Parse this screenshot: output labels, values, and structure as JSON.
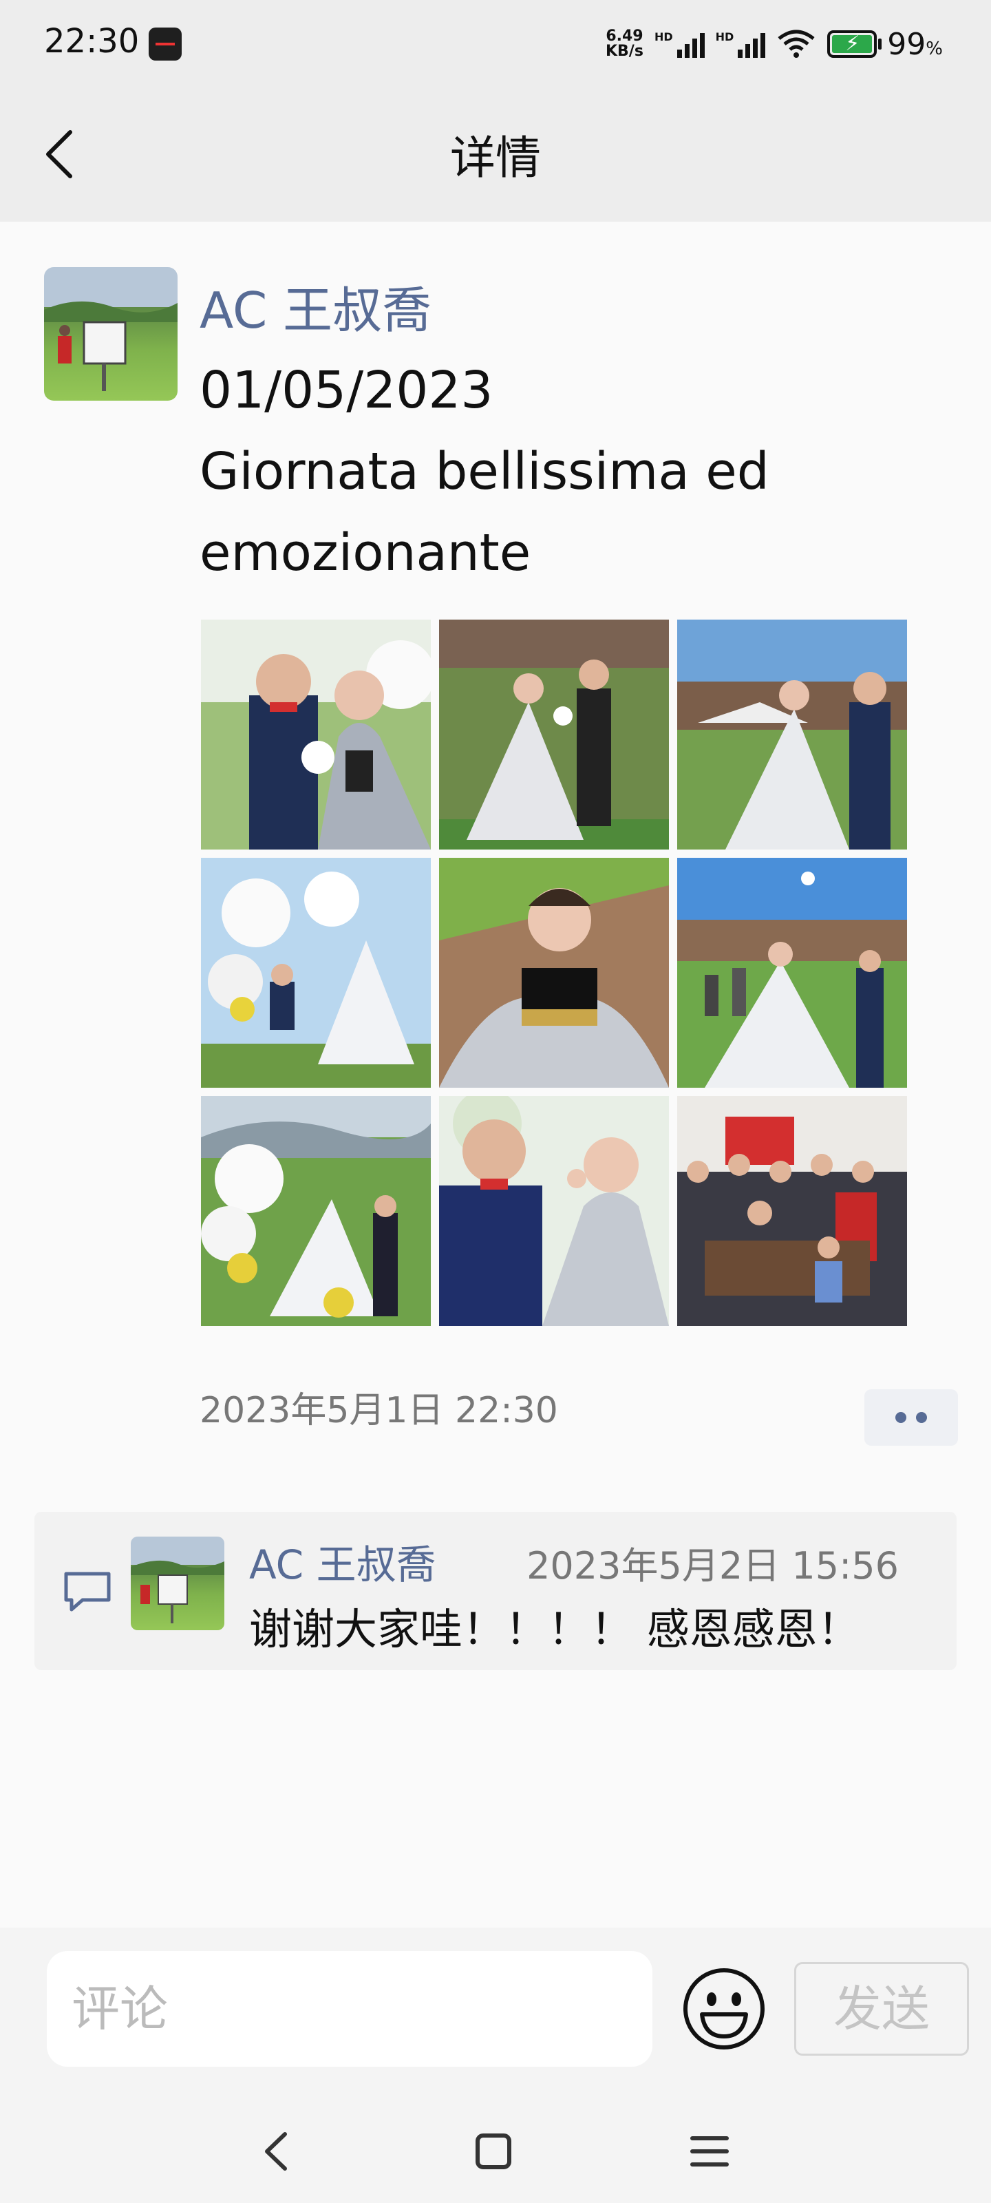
{
  "status_bar": {
    "time": "22:30",
    "net_speed_value": "6.49",
    "net_speed_unit": "KB/s",
    "hd_label": "HD",
    "battery_percent": "99",
    "battery_unit": "%"
  },
  "header": {
    "title": "详情"
  },
  "post": {
    "author": "AC 王叔喬",
    "lines": [
      "01/05/2023",
      "Giornata bellissima ed",
      "emozionante"
    ],
    "photos": [
      {
        "name": "wedding-photo-1"
      },
      {
        "name": "wedding-photo-2"
      },
      {
        "name": "wedding-photo-3"
      },
      {
        "name": "wedding-photo-4"
      },
      {
        "name": "wedding-photo-5"
      },
      {
        "name": "wedding-photo-6"
      },
      {
        "name": "wedding-photo-7"
      },
      {
        "name": "wedding-photo-8"
      },
      {
        "name": "wedding-photo-9"
      }
    ],
    "time": "2023年5月1日 22:30"
  },
  "comments": [
    {
      "author": "AC 王叔喬",
      "time": "2023年5月2日 15:56",
      "text": "谢谢大家哇！！！！ 感恩感恩！"
    }
  ],
  "composer": {
    "placeholder": "评论",
    "send_label": "发送"
  },
  "colors": {
    "link": "#576b95",
    "background": "#fafafa",
    "bar": "#ededed"
  }
}
